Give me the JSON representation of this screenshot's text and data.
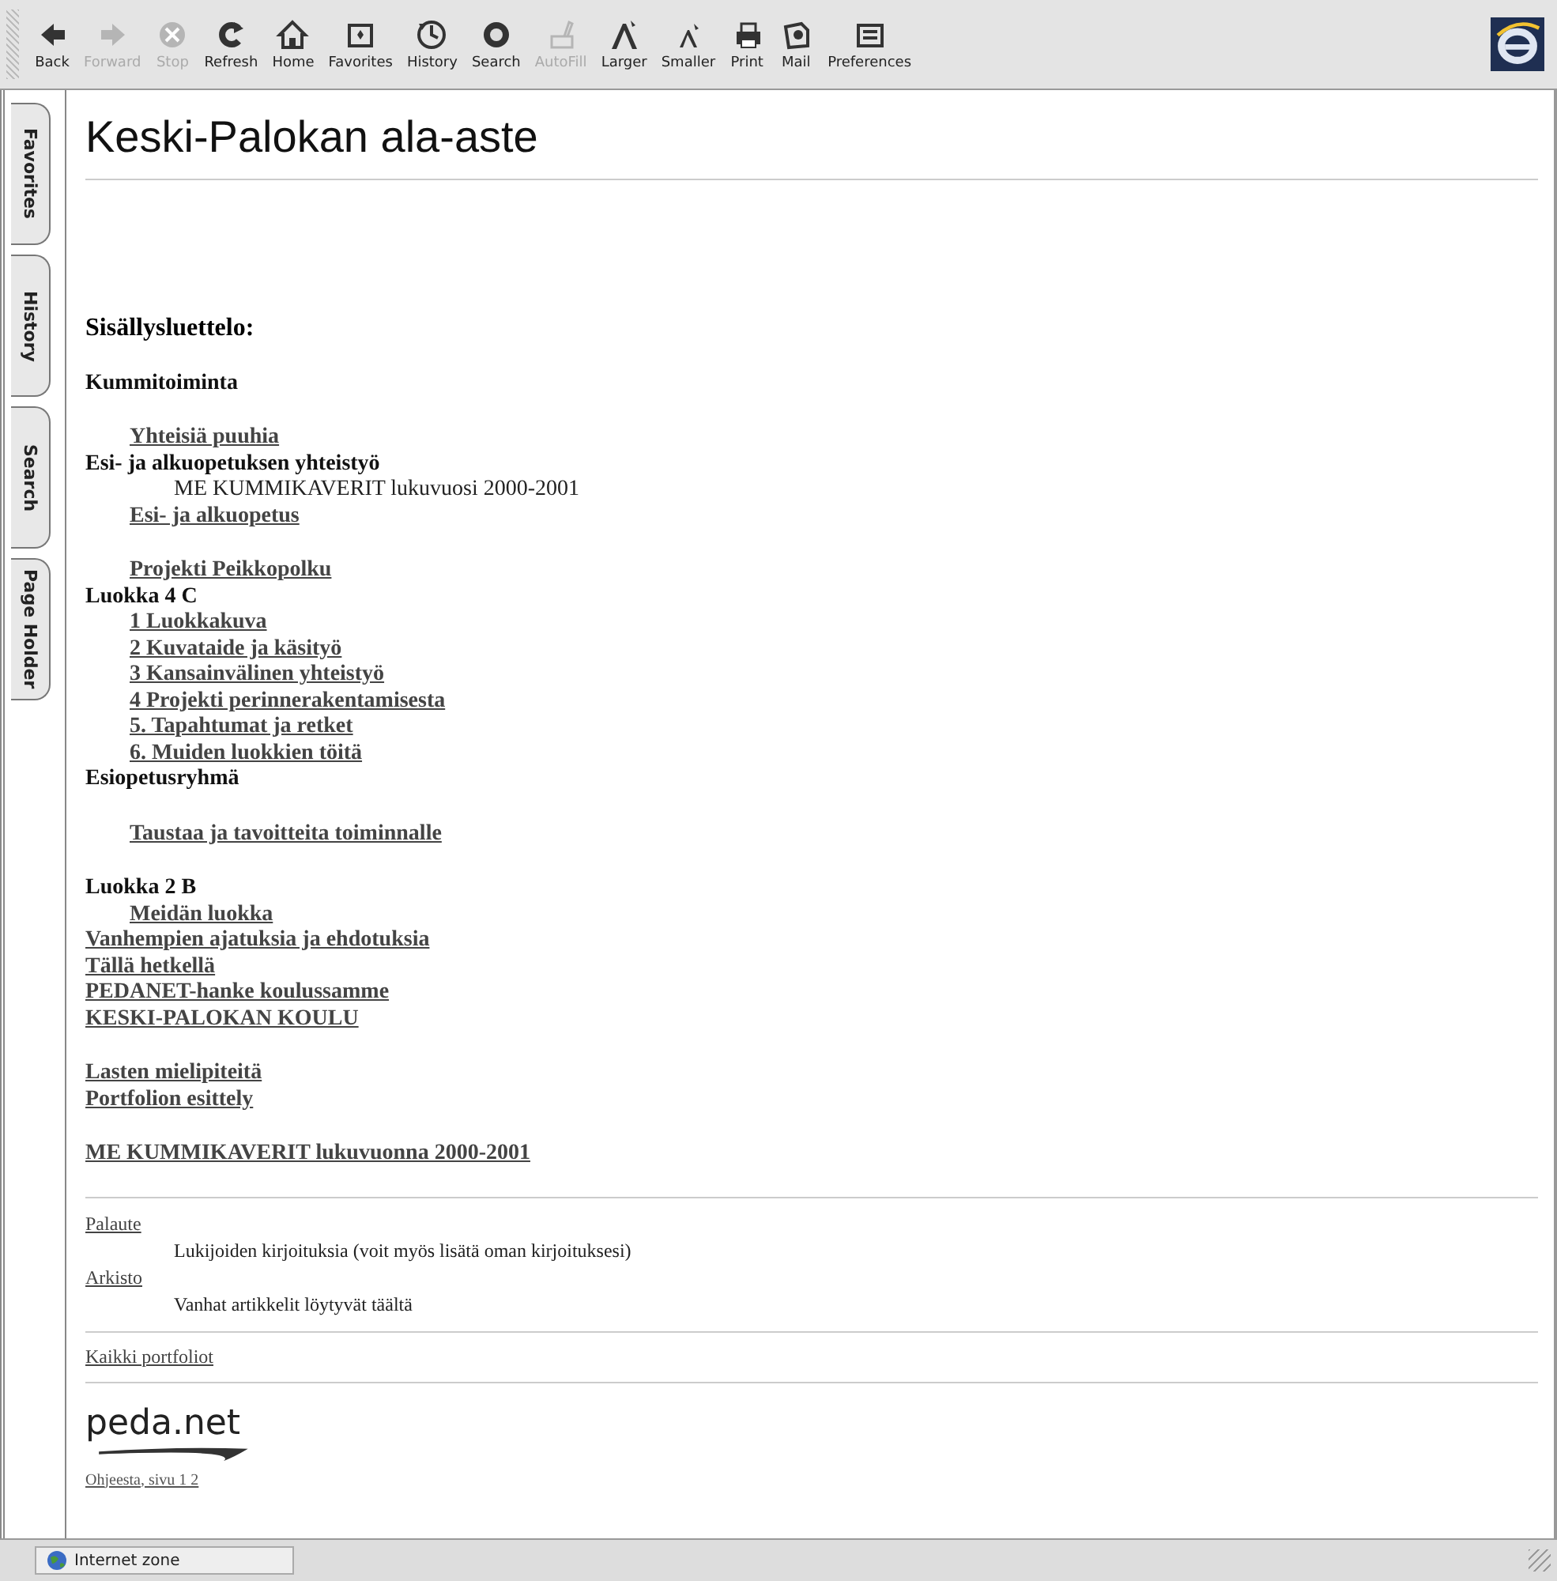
{
  "toolbar": {
    "buttons": [
      {
        "label": "Back",
        "disabled": false
      },
      {
        "label": "Forward",
        "disabled": true
      },
      {
        "label": "Stop",
        "disabled": true
      },
      {
        "label": "Refresh",
        "disabled": false
      },
      {
        "label": "Home",
        "disabled": false
      },
      {
        "label": "Favorites",
        "disabled": false
      },
      {
        "label": "History",
        "disabled": false
      },
      {
        "label": "Search",
        "disabled": false
      },
      {
        "label": "AutoFill",
        "disabled": true
      },
      {
        "label": "Larger",
        "disabled": false
      },
      {
        "label": "Smaller",
        "disabled": false
      },
      {
        "label": "Print",
        "disabled": false
      },
      {
        "label": "Mail",
        "disabled": false
      },
      {
        "label": "Preferences",
        "disabled": false
      }
    ]
  },
  "sidebar": {
    "tabs": [
      "Favorites",
      "History",
      "Search",
      "Page Holder"
    ]
  },
  "page": {
    "title": "Keski-Palokan ala-aste",
    "contents": [
      [
        {
          "kind": "title",
          "text": "Sisällysluettelo:"
        }
      ],
      [
        {
          "kind": "label",
          "text": "Kummitoiminta"
        }
      ],
      [
        {
          "kind": "indent",
          "children": [
            {
              "kind": "link",
              "text": "Yhteisiä puuhia"
            }
          ]
        },
        {
          "kind": "label",
          "text": "Esi- ja alkuopetuksen yhteistyö",
          "children": [
            {
              "kind": "note",
              "text": "ME KUMMIKAVERIT lukuvuosi 2000-2001"
            },
            {
              "kind": "link",
              "text": "Esi- ja alkuopetus"
            }
          ]
        }
      ],
      [
        {
          "kind": "indent",
          "children": [
            {
              "kind": "link",
              "text": "Projekti Peikkopolku"
            }
          ]
        },
        {
          "kind": "label",
          "text": "Luokka 4 C",
          "children": [
            {
              "kind": "link",
              "text": "1 Luokkakuva"
            },
            {
              "kind": "link",
              "text": "2 Kuvataide ja käsityö"
            },
            {
              "kind": "link",
              "text": "3 Kansainvälinen yhteistyö"
            },
            {
              "kind": "link",
              "text": "4 Projekti perinnerakentamisesta"
            },
            {
              "kind": "link",
              "text": "5. Tapahtumat ja retket"
            },
            {
              "kind": "link",
              "text": "6. Muiden luokkien töitä"
            }
          ]
        },
        {
          "kind": "label",
          "text": "Esiopetusryhmä"
        }
      ],
      [
        {
          "kind": "indent",
          "children": [
            {
              "kind": "link",
              "text": "Taustaa ja tavoitteita toiminnalle"
            }
          ]
        }
      ],
      [
        {
          "kind": "label",
          "text": "Luokka 2 B",
          "children": [
            {
              "kind": "link",
              "text": "Meidän luokka"
            }
          ]
        },
        {
          "kind": "link",
          "text": "Vanhempien ajatuksia ja ehdotuksia"
        },
        {
          "kind": "link",
          "text": "Tällä hetkellä"
        },
        {
          "kind": "link",
          "text": "PEDANET-hanke koulussamme"
        },
        {
          "kind": "link",
          "text": "KESKI-PALOKAN KOULU"
        }
      ],
      [
        {
          "kind": "link",
          "text": "Lasten mielipiteitä"
        },
        {
          "kind": "link",
          "text": "Portfolion esittely"
        }
      ],
      [
        {
          "kind": "link",
          "text": "ME KUMMIKAVERIT lukuvuonna 2000-2001"
        }
      ]
    ],
    "sections": [
      {
        "link": "Palaute",
        "description": "Lukijoiden kirjoituksia (voit myös lisätä oman kirjoituksesi)"
      },
      {
        "link": "Arkisto",
        "description": "Vanhat artikkelit löytyvät täältä"
      }
    ],
    "all_portfolios": "Kaikki portfoliot",
    "logo": "peda.net",
    "footer_link": "Ohjeesta, sivu 1 2"
  },
  "status_bar": {
    "zone": "Internet zone"
  }
}
